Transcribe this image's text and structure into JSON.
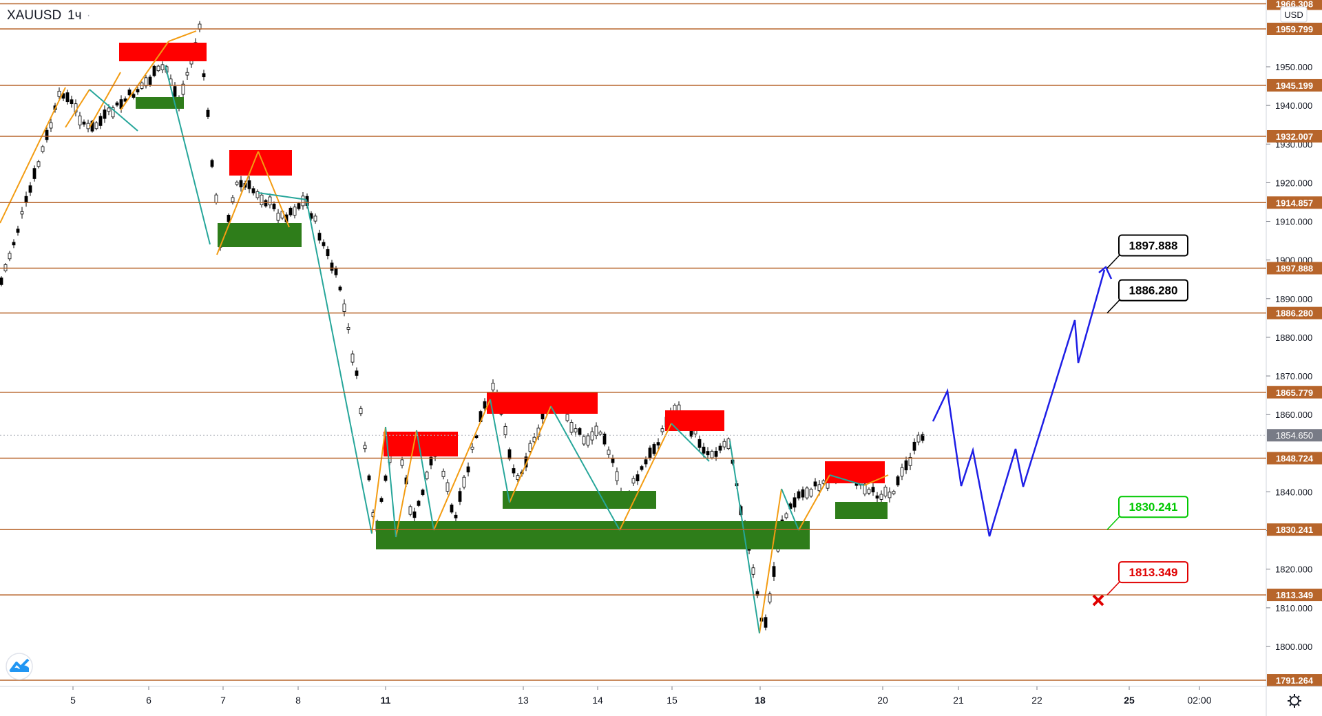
{
  "header": {
    "symbol": "XAUUSD",
    "interval": "1ч",
    "currency": "USD"
  },
  "price_axis": {
    "ticks": [
      "1950.000",
      "1940.000",
      "1930.000",
      "1920.000",
      "1910.000",
      "1900.000",
      "1890.000",
      "1880.000",
      "1870.000",
      "1860.000",
      "1840.000",
      "1830.000",
      "1820.000",
      "1810.000",
      "1800.000"
    ]
  },
  "time_axis": {
    "labels": [
      "5",
      "6",
      "7",
      "8",
      "11",
      "13",
      "14",
      "15",
      "18",
      "20",
      "21",
      "22",
      "25",
      "02:00"
    ],
    "bold": [
      "11",
      "18",
      "25"
    ]
  },
  "levels": [
    {
      "label": "1966.308",
      "color": "#b7652b"
    },
    {
      "label": "1959.799",
      "color": "#b7652b"
    },
    {
      "label": "1945.199",
      "color": "#b7652b"
    },
    {
      "label": "1932.007",
      "color": "#b7652b"
    },
    {
      "label": "1914.857",
      "color": "#b7652b"
    },
    {
      "label": "1897.888",
      "color": "#b7652b"
    },
    {
      "label": "1886.280",
      "color": "#b7652b"
    },
    {
      "label": "1865.779",
      "color": "#b7652b"
    },
    {
      "label": "1848.724",
      "color": "#b7652b"
    },
    {
      "label": "1830.241",
      "color": "#b7652b"
    },
    {
      "label": "1813.349",
      "color": "#b7652b"
    },
    {
      "label": "1791.264",
      "color": "#b7652b"
    }
  ],
  "current_price": {
    "label": "1854.650",
    "color": "#787b86"
  },
  "callouts": [
    {
      "label": "1897.888",
      "color": "#000000"
    },
    {
      "label": "1886.280",
      "color": "#000000"
    },
    {
      "label": "1830.241",
      "color": "#00c800"
    },
    {
      "label": "1813.349",
      "color": "#e00000"
    }
  ],
  "colors": {
    "supply_zone": "#ff0000",
    "demand_zone": "#2e7d1a",
    "zigzag_up": "#f39c12",
    "zigzag_down": "#26a69a",
    "forecast": "#1e1ee6",
    "level_line": "#b7652b"
  },
  "icons": {
    "brand": "tradingview-logo-icon",
    "settings": "gear-icon",
    "stop": "x-mark-icon"
  }
}
